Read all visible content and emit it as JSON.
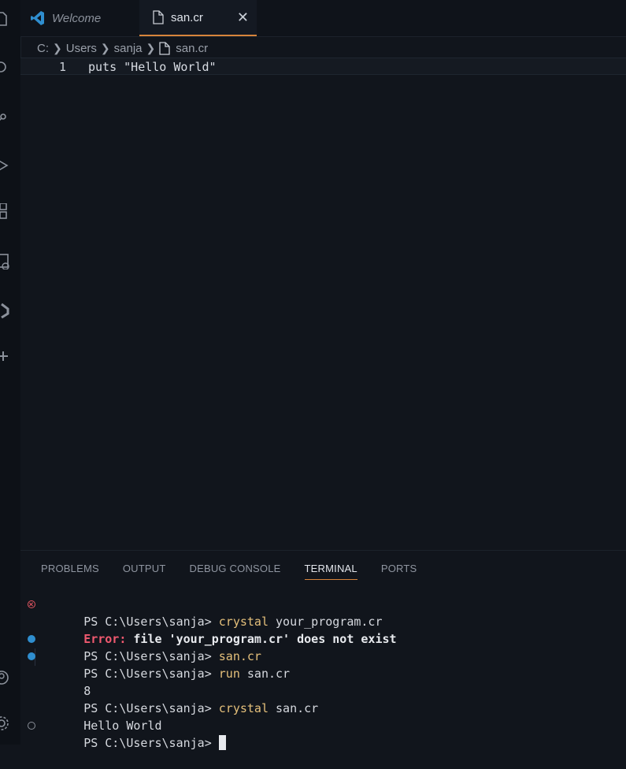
{
  "tabs": {
    "welcome": "Welcome",
    "active": "san.cr"
  },
  "breadcrumb": [
    "C:",
    "Users",
    "sanja",
    "san.cr"
  ],
  "editor": {
    "line_number": "1",
    "code": "puts \"Hello World\""
  },
  "panel": {
    "tabs": [
      "PROBLEMS",
      "OUTPUT",
      "DEBUG CONSOLE",
      "TERMINAL",
      "PORTS"
    ],
    "active_tab": "TERMINAL"
  },
  "terminal": {
    "prompt": "PS C:\\Users\\sanja> ",
    "cmd1_exe": "crystal",
    "cmd1_arg": " your_program.cr",
    "error_label": "Error:",
    "error_text": " file 'your_program.cr' does not exist",
    "cmd2": "san.cr",
    "cmd3_exe": "run",
    "cmd3_arg": " san.cr",
    "out3": "8",
    "cmd4_exe": "crystal",
    "cmd4_arg": " san.cr",
    "out4": "Hello World"
  },
  "colors": {
    "accent": "#d7843b",
    "command": "#e5c07b",
    "error": "#ef596f",
    "success_dot": "#2f8ecf"
  }
}
